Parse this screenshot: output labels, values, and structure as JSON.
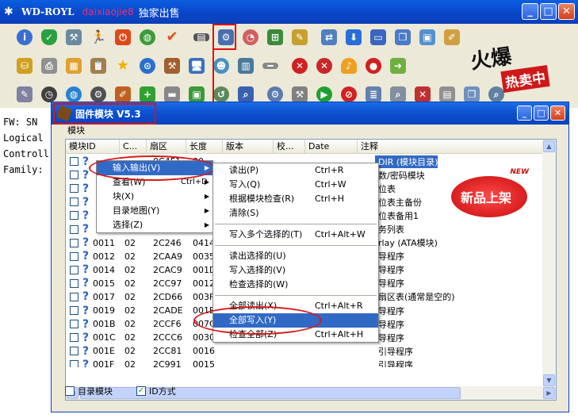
{
  "main_window": {
    "logo": "✱",
    "title": "WD-ROYL",
    "watermark": "daixiaojie8",
    "subtitle": "独家出售"
  },
  "window_buttons": {
    "minimize": "_",
    "maximize": "□",
    "close": "✕"
  },
  "promo_fire": {
    "big": "火爆",
    "small": "热卖中"
  },
  "left_panel": {
    "lines": [
      "FW: SN",
      "Logical",
      "Controll",
      "Family:"
    ]
  },
  "child_window": {
    "title": "固件模块 V5.3",
    "menu": "模块",
    "columns": [
      "模块ID",
      "C...",
      "扇区",
      "长度",
      "版本",
      "校...",
      "Date",
      "注释"
    ],
    "rows": [
      {
        "id": "",
        "c": "",
        "sector": "0C4F1",
        "len": "00",
        "ver": "",
        "date": "",
        "desc": "DIR (模块目录)",
        "sel": true
      },
      {
        "id": "",
        "c": "",
        "sector": "",
        "len": "",
        "ver": "",
        "date": "",
        "desc": "数/密码模块"
      },
      {
        "id": "",
        "c": "",
        "sector": "",
        "len": "",
        "ver": "",
        "date": "",
        "desc": "位表"
      },
      {
        "id": "",
        "c": "",
        "sector": "",
        "len": "",
        "ver": "",
        "date": "",
        "desc": "位表主备份"
      },
      {
        "id": "",
        "c": "",
        "sector": "",
        "len": "",
        "ver": "",
        "date": "",
        "desc": "位表备用1"
      },
      {
        "id": "",
        "c": "",
        "sector": "",
        "len": "",
        "ver": "",
        "date": "",
        "desc": "务列表"
      },
      {
        "id": "0011",
        "c": "02",
        "sector": "2C246",
        "len": "0414",
        "ver": "",
        "date": "",
        "desc": "rlay (ATA模块)"
      },
      {
        "id": "0012",
        "c": "02",
        "sector": "2CAA9",
        "len": "0035",
        "ver": "",
        "date": "",
        "desc": "导程序"
      },
      {
        "id": "0014",
        "c": "02",
        "sector": "2CAC9",
        "len": "001D",
        "ver": "",
        "date": "",
        "desc": "导程序"
      },
      {
        "id": "0015",
        "c": "02",
        "sector": "2CC97",
        "len": "0012",
        "ver": "",
        "date": "",
        "desc": "导程序"
      },
      {
        "id": "0017",
        "c": "02",
        "sector": "2CD66",
        "len": "003F",
        "ver": "",
        "date": "",
        "desc": "扇区表(通常是空的)"
      },
      {
        "id": "0019",
        "c": "02",
        "sector": "2CADE",
        "len": "001E",
        "ver": "",
        "date": "",
        "desc": "导程序"
      },
      {
        "id": "001B",
        "c": "02",
        "sector": "2CCF6",
        "len": "007C",
        "ver": "",
        "date": "",
        "desc": "导程序"
      },
      {
        "id": "001C",
        "c": "02",
        "sector": "2CCC6",
        "len": "0030",
        "ver": "",
        "date": "",
        "desc": "导程序"
      },
      {
        "id": "001E",
        "c": "02",
        "sector": "2CC81",
        "len": "0016",
        "ver": "",
        "date": "",
        "desc": "引导程序"
      },
      {
        "id": "001F",
        "c": "02",
        "sector": "2C991",
        "len": "0015",
        "ver": "",
        "date": "",
        "desc": "引导程序"
      }
    ],
    "check_module_dir": "目录模块",
    "check_id_mode": "ID方式",
    "check_id_mode_checked": "✓"
  },
  "context_menu": {
    "items": [
      {
        "label": "输入输出(V)",
        "shortcut": "",
        "arrow": "▶",
        "hl": true
      },
      {
        "label": "查看(W)",
        "shortcut": "Ctrl+D",
        "arrow": "▶"
      },
      {
        "label": "块(X)",
        "shortcut": "",
        "arrow": "▶"
      },
      {
        "label": "目录地图(Y)",
        "shortcut": "",
        "arrow": "▶"
      },
      {
        "label": "选择(Z)",
        "shortcut": "",
        "arrow": "▶"
      }
    ]
  },
  "submenu": {
    "groups": [
      [
        {
          "label": "读出(P)",
          "shortcut": "Ctrl+R"
        },
        {
          "label": "写入(Q)",
          "shortcut": "Ctrl+W"
        },
        {
          "label": "根据模块检查(R)",
          "shortcut": "Ctrl+H"
        },
        {
          "label": "清除(S)",
          "shortcut": ""
        }
      ],
      [
        {
          "label": "写入多个选择的(T)",
          "shortcut": "Ctrl+Alt+W"
        }
      ],
      [
        {
          "label": "读出选择的(U)",
          "shortcut": ""
        },
        {
          "label": "写入选择的(V)",
          "shortcut": ""
        },
        {
          "label": "检查选择的(W)",
          "shortcut": ""
        }
      ],
      [
        {
          "label": "全部读出(X)",
          "shortcut": "Ctrl+Alt+R"
        },
        {
          "label": "全部写入(Y)",
          "shortcut": "",
          "hl": true
        },
        {
          "label": "检查全部(Z)",
          "shortcut": "Ctrl+Alt+H"
        }
      ]
    ]
  },
  "promo_new": {
    "new": "NEW",
    "text": "新品上架"
  },
  "colors": {
    "accent": "#0a46c8",
    "highlight": "#316ac5",
    "annotation": "#e01010"
  }
}
